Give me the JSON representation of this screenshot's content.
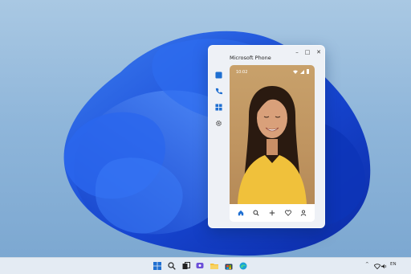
{
  "window": {
    "title": "Microsoft Phone",
    "controls": {
      "minimize": "–",
      "maximize": "□",
      "close": "✕"
    }
  },
  "sidebar": {
    "items": [
      {
        "icon": "messages-icon",
        "color": "#1f6fd1"
      },
      {
        "icon": "phone-icon",
        "color": "#1f6fd1"
      },
      {
        "icon": "apps-icon",
        "color": "#1f6fd1"
      },
      {
        "icon": "gear-icon",
        "color": "#555555"
      }
    ]
  },
  "phone": {
    "status_time": "10:02",
    "status_icons": [
      "wifi-icon",
      "signal-icon",
      "battery-icon"
    ],
    "navbar": [
      {
        "icon": "home-icon",
        "active": true
      },
      {
        "icon": "search-icon",
        "active": false
      },
      {
        "icon": "add-icon",
        "active": false
      },
      {
        "icon": "heart-icon",
        "active": false
      },
      {
        "icon": "profile-icon",
        "active": false
      }
    ]
  },
  "taskbar": {
    "icons": [
      "windows-start-icon",
      "search-icon",
      "task-view-icon",
      "chat-icon",
      "file-explorer-icon",
      "store-icon",
      "edge-icon"
    ],
    "tray": {
      "chevron": "^",
      "lang": "EN"
    }
  },
  "colors": {
    "accent": "#1f6fd1",
    "window_bg": "#eef1f6",
    "taskbar_bg": "#e4ebf3"
  }
}
